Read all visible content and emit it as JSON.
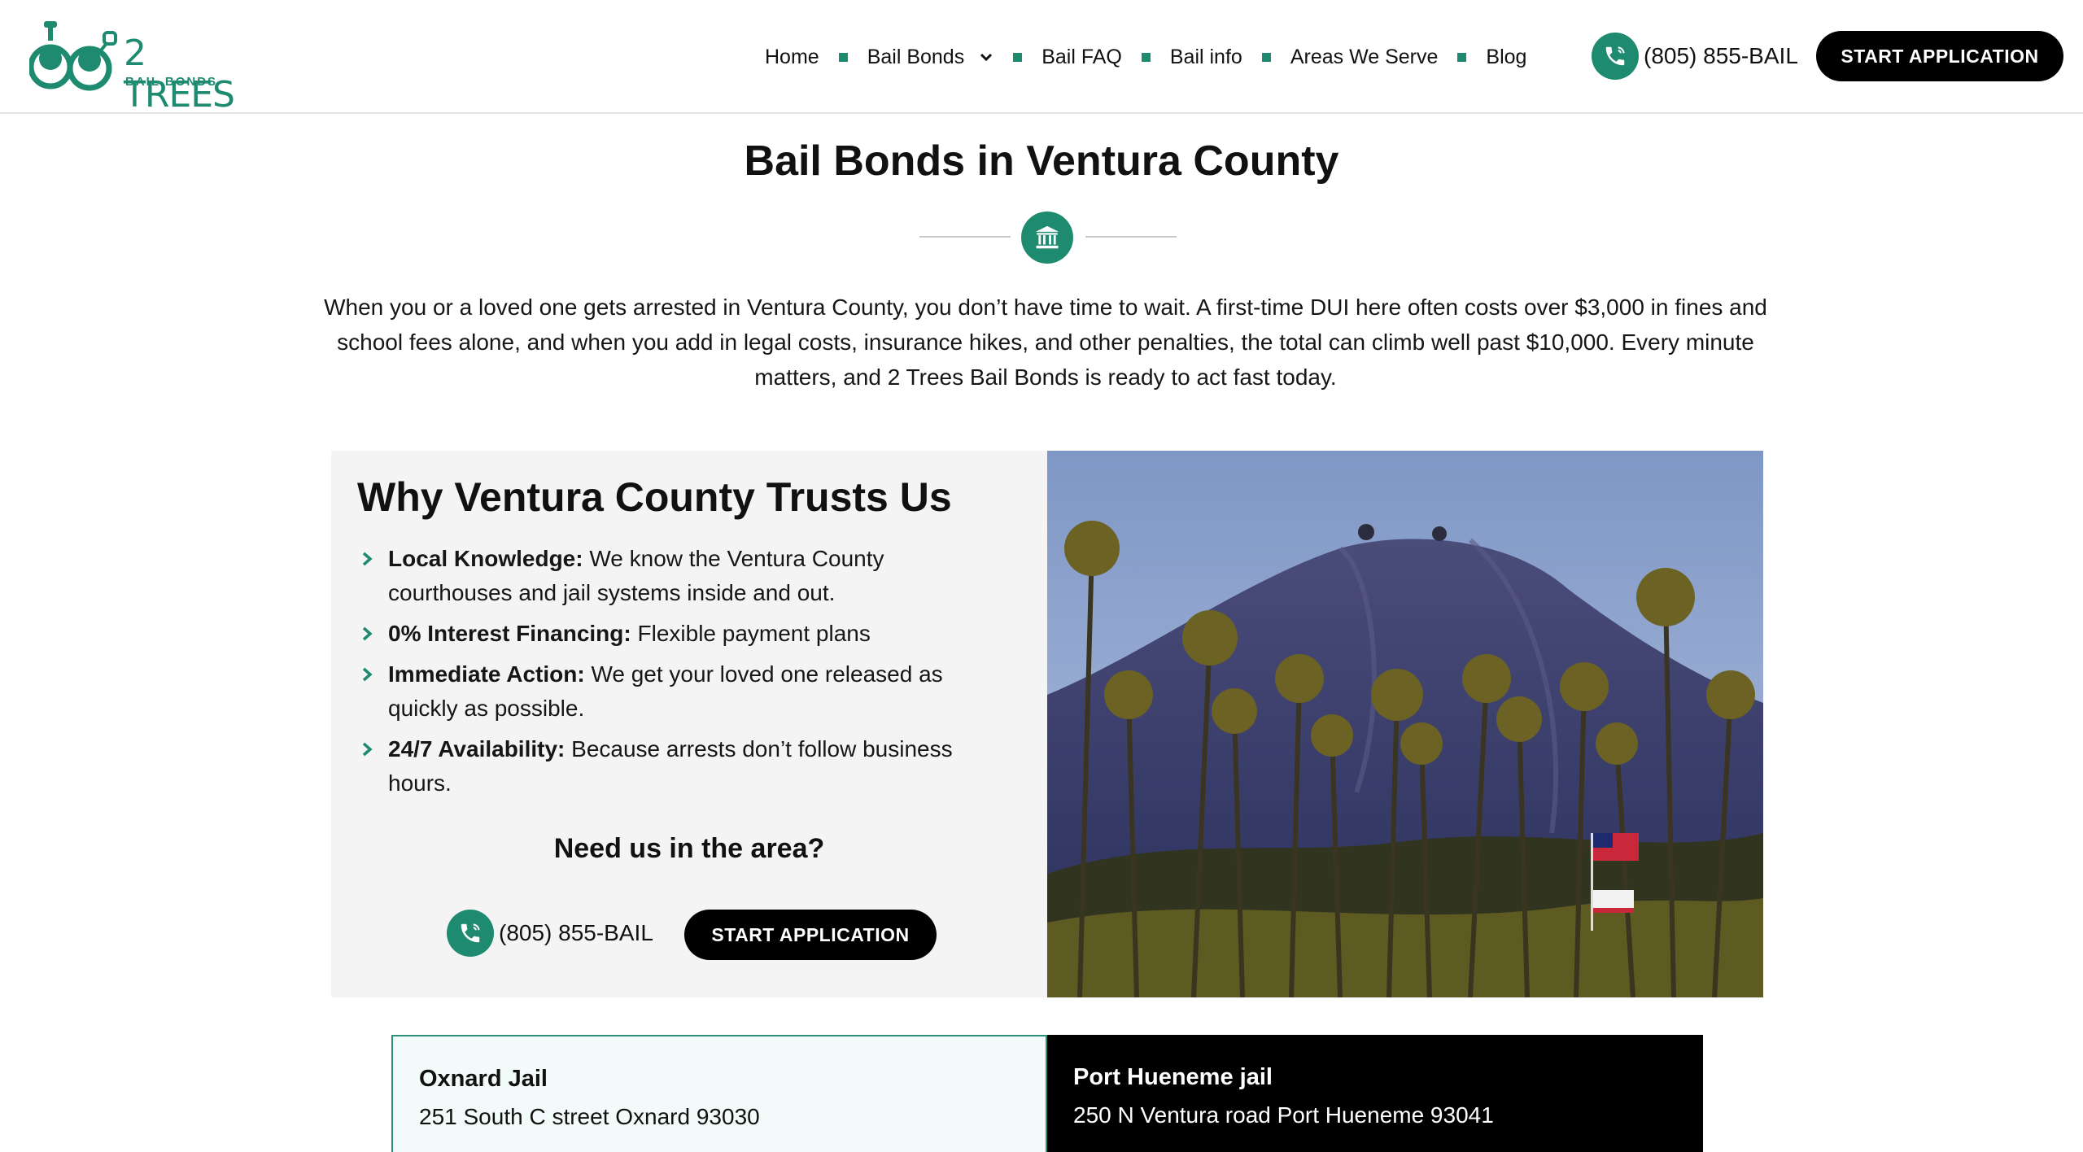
{
  "header": {
    "logo": {
      "name": "2 TREES",
      "sub": "BAIL BONDS"
    },
    "nav": [
      {
        "label": "Home"
      },
      {
        "label": "Bail Bonds",
        "has_dropdown": true
      },
      {
        "label": "Bail FAQ"
      },
      {
        "label": "Bail info"
      },
      {
        "label": "Areas We Serve"
      },
      {
        "label": "Blog"
      }
    ],
    "phone": "(805) 855-BAIL",
    "cta": "START APPLICATION"
  },
  "hero": {
    "title": "Bail Bonds in Ventura County",
    "icon": "courthouse-icon",
    "intro": "When you or a loved one gets arrested in Ventura County, you don’t have time to wait. A first-time DUI here often costs over $3,000 in fines and school fees alone, and when you add in legal costs, insurance hikes, and other penalties, the total can climb well past $10,000. Every minute matters, and 2 Trees Bail Bonds is ready to act fast today."
  },
  "trust": {
    "title": "Why Ventura County Trusts Us",
    "items": [
      {
        "strong": "Local Knowledge:",
        "text": " We know the Ventura County courthouses and jail systems inside and out."
      },
      {
        "strong": "0% Interest Financing:",
        "text": " Flexible payment plans"
      },
      {
        "strong": "Immediate Action:",
        "text": " We get your loved one released as quickly as possible."
      },
      {
        "strong": "24/7 Availability:",
        "text": " Because arrests don’t follow business hours."
      }
    ],
    "need_title": "Need us in the area?",
    "phone": "(805) 855-BAIL",
    "cta": "START APPLICATION"
  },
  "jails": [
    {
      "name": "Oxnard Jail",
      "address": "251 South C street Oxnard 93030"
    },
    {
      "name": "Port Hueneme jail",
      "address": "250 N Ventura road Port Hueneme 93041"
    }
  ],
  "colors": {
    "accent": "#1e8a70",
    "dark": "#000000",
    "panel": "#f4f4f4"
  }
}
